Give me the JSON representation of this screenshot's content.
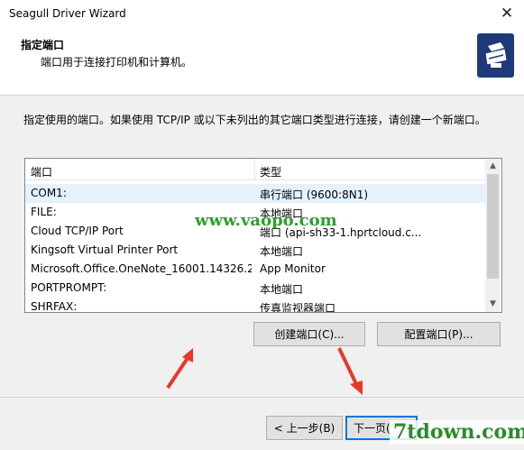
{
  "window": {
    "title": "Seagull Driver Wizard",
    "close_glyph": "✕"
  },
  "header": {
    "title": "指定端口",
    "subtitle": "端口用于连接打印机和计算机。",
    "icon": "printer-icon"
  },
  "description": "指定使用的端口。如果使用 TCP/IP 或以下未列出的其它端口类型进行连接，请创建一个新端口。",
  "list": {
    "columns": [
      "端口",
      "类型"
    ],
    "rows": [
      {
        "port": "COM1:",
        "type": "串行端口 (9600:8N1)"
      },
      {
        "port": "FILE:",
        "type": "本地端口"
      },
      {
        "port": "Cloud TCP/IP Port",
        "type": "端口 (api-sh33-1.hprtcloud.c..."
      },
      {
        "port": "Kingsoft Virtual Printer Port",
        "type": "本地端口"
      },
      {
        "port": "Microsoft.Office.OneNote_16001.14326.2...",
        "type": "App Monitor"
      },
      {
        "port": "PORTPROMPT:",
        "type": "本地端口"
      },
      {
        "port": "SHRFAX:",
        "type": "传真监视器端口"
      }
    ]
  },
  "buttons": {
    "create_port": "创建端口(C)...",
    "configure_port": "配置端口(P)...",
    "back": "< 上一步(B)",
    "next": "下一页("
  },
  "watermarks": {
    "top": "www.vaopo.com",
    "bottom": "7tdown.com"
  },
  "colors": {
    "selection": "#e5f1fb",
    "accent": "#0078d7",
    "arrow": "#e8382a"
  }
}
